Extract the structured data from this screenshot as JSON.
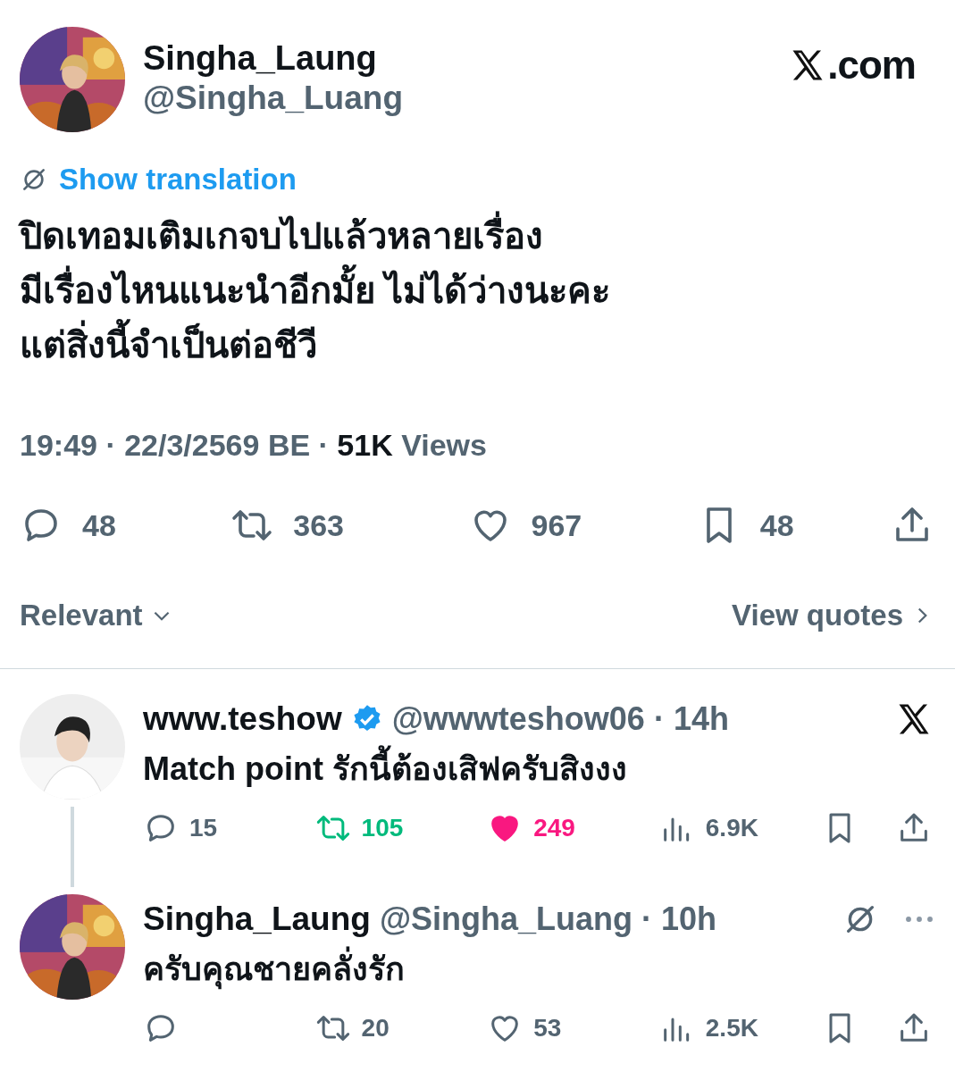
{
  "post": {
    "author": {
      "name": "Singha_Laung",
      "handle": "@Singha_Luang"
    },
    "brand": ".com",
    "translate_link": "Show translation",
    "text_lines": [
      "ปิดเทอมเติมเกจบไปแล้วหลายเรื่อง",
      "มีเรื่องไหนแนะนำอีกมั้ย ไม่ได้ว่างนะคะ",
      "แต่สิ่งนี้จำเป็นต่อชีวี"
    ],
    "meta": "19:49 · 22/3/2569 BE · **51K** Views",
    "actions": [
      {
        "kind": "reply",
        "count": "48"
      },
      {
        "kind": "repost",
        "count": "363"
      },
      {
        "kind": "like",
        "count": "967"
      },
      {
        "kind": "bookmark",
        "count": "48"
      },
      {
        "kind": "share"
      }
    ]
  },
  "sort": {
    "label": "Relevant"
  },
  "view_quotes": "View quotes",
  "replies": [
    {
      "name": "www.teshow",
      "verified": true,
      "meta": "@wwwteshow06 · 14h",
      "corner": {
        "kind": "x-logo"
      },
      "thread_line": true,
      "text": "Match point รักนี้ต้องเสิฟครับสิงงง",
      "actions": [
        {
          "kind": "reply",
          "count": "15"
        },
        {
          "kind": "repost",
          "count": "105",
          "active": true
        },
        {
          "kind": "like",
          "count": "249",
          "active": true
        },
        {
          "kind": "views",
          "count": "6.9K"
        },
        {
          "kind": "bookmark"
        },
        {
          "kind": "share"
        }
      ]
    },
    {
      "name": "Singha_Laung",
      "verified": false,
      "meta": "@Singha_Luang · 10h",
      "corner": {
        "kind": "translate-more"
      },
      "thread_line": false,
      "text": "ครับคุณชายคลั่งรัก",
      "actions": [
        {
          "kind": "reply"
        },
        {
          "kind": "repost",
          "count": "20",
          "active": false
        },
        {
          "kind": "like",
          "count": "53",
          "active": false
        },
        {
          "kind": "views",
          "count": "2.5K"
        },
        {
          "kind": "bookmark"
        },
        {
          "kind": "share"
        }
      ]
    }
  ]
}
